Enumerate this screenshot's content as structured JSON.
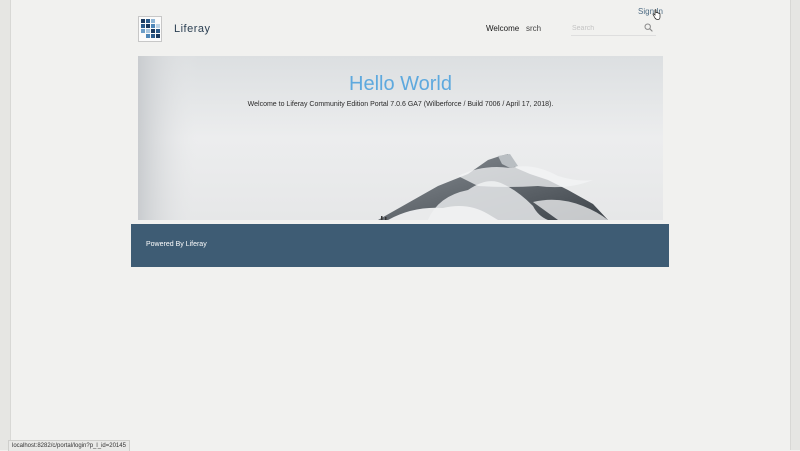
{
  "header": {
    "sign_in_label": "Sign In",
    "site_name": "Liferay",
    "nav": [
      {
        "label": "Welcome"
      },
      {
        "label": "srch"
      }
    ],
    "search": {
      "placeholder": "Search",
      "value": ""
    }
  },
  "hero": {
    "title": "Hello World",
    "subtitle": "Welcome to Liferay Community Edition Portal 7.0.6 GA7 (Wilberforce / Build 7006 / April 17, 2018)."
  },
  "footer": {
    "prefix": "Powered By ",
    "link_label": "Liferay"
  },
  "status_bar": {
    "url": "localhost:8282/c/portal/login?p_l_id=20145"
  },
  "colors": {
    "footer_bg": "#3e5c74",
    "hero_title": "#5ea9de",
    "page_bg": "#f1f1ef"
  },
  "icons": {
    "logo": "liferay-logo-icon",
    "search": "search-icon",
    "cursor": "hand-cursor-icon"
  }
}
